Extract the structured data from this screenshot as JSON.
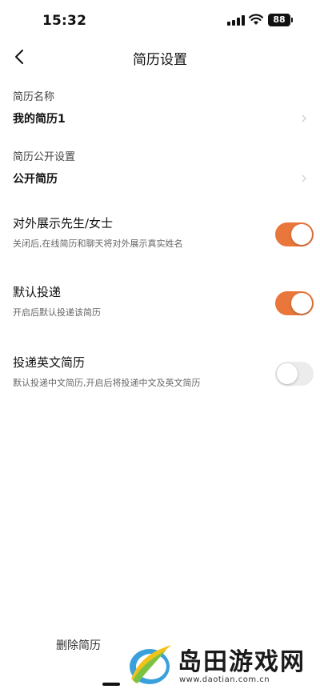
{
  "status_bar": {
    "time": "15:32",
    "battery": "88"
  },
  "nav": {
    "title": "简历设置"
  },
  "fields": [
    {
      "label": "简历名称",
      "value": "我的简历1"
    },
    {
      "label": "简历公开设置",
      "value": "公开简历"
    }
  ],
  "settings": [
    {
      "title": "对外展示先生/女士",
      "desc": "关闭后,在线简历和聊天将对外展示真实姓名",
      "on": true
    },
    {
      "title": "默认投递",
      "desc": "开启后默认投递该简历",
      "on": true
    },
    {
      "title": "投递英文简历",
      "desc": "默认投递中文简历,开启后将投递中文及英文简历",
      "on": false
    }
  ],
  "footer": {
    "delete_label": "删除简历"
  },
  "watermark": {
    "brand": "岛田游戏网",
    "url": "www.daotian.com.cn"
  },
  "colors": {
    "accent": "#e9763a",
    "toggle_off": "#ececec"
  }
}
